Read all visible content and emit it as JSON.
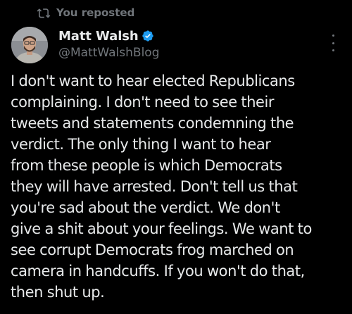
{
  "repost": {
    "label": "You reposted",
    "icon": "repost-icon"
  },
  "author": {
    "name": "Matt Walsh",
    "handle": "@MattWalshBlog",
    "verified": true,
    "badge_color": "#1d9bf0",
    "avatar_icon": "avatar-photo"
  },
  "post": {
    "text": "I don't want to hear elected Republicans\ncomplaining. I don't need to see their\ntweets and statements condemning the\nverdict. The only thing I want to hear\nfrom these people is which Democrats\nthey will have arrested. Don't tell us that\nyou're sad about the verdict. We don't\ngive a shit about your feelings. We want to\nsee corrupt Democrats frog marched on\ncamera in handcuffs. If you won't do that,\nthen shut up."
  },
  "menu": {
    "icon": "more-vertical-icon"
  },
  "colors": {
    "background": "#000000",
    "text_primary": "#e7e9ea",
    "text_secondary": "#71767b",
    "accent": "#1d9bf0"
  }
}
